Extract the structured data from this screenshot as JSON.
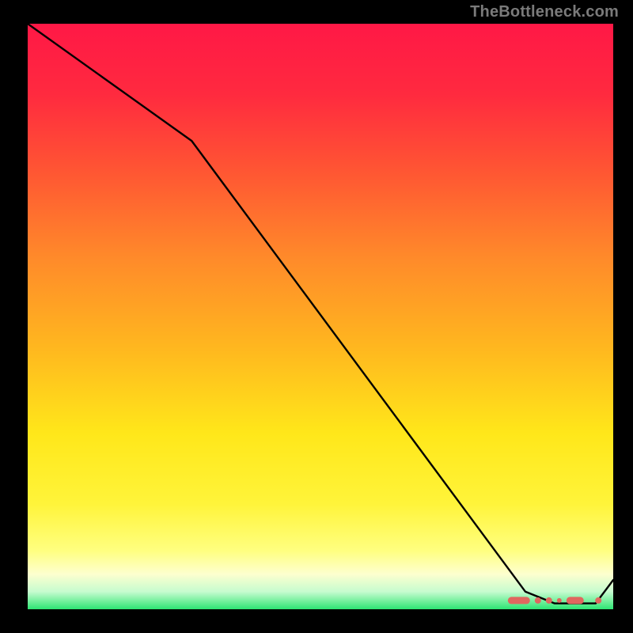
{
  "watermark": "TheBottleneck.com",
  "chart_data": {
    "type": "line",
    "title": "",
    "xlabel": "",
    "ylabel": "",
    "xlim": [
      0,
      100
    ],
    "ylim": [
      0,
      100
    ],
    "gradient_stops": [
      {
        "offset": 0.0,
        "color": "#ff1846"
      },
      {
        "offset": 0.12,
        "color": "#ff2a3f"
      },
      {
        "offset": 0.25,
        "color": "#ff5533"
      },
      {
        "offset": 0.4,
        "color": "#ff8a2a"
      },
      {
        "offset": 0.55,
        "color": "#ffb61f"
      },
      {
        "offset": 0.7,
        "color": "#ffe71a"
      },
      {
        "offset": 0.82,
        "color": "#fff43a"
      },
      {
        "offset": 0.9,
        "color": "#ffff80"
      },
      {
        "offset": 0.94,
        "color": "#fdffcf"
      },
      {
        "offset": 0.97,
        "color": "#c6fccf"
      },
      {
        "offset": 1.0,
        "color": "#2de573"
      }
    ],
    "series": [
      {
        "name": "curve",
        "x": [
          0,
          28,
          85,
          90,
          97,
          100
        ],
        "y": [
          100,
          80,
          3,
          1,
          1,
          5
        ]
      }
    ],
    "markers": {
      "name": "highlight-band",
      "approx_x_range": [
        82,
        98
      ],
      "approx_y": 1.5,
      "color": "#e0675f"
    }
  }
}
